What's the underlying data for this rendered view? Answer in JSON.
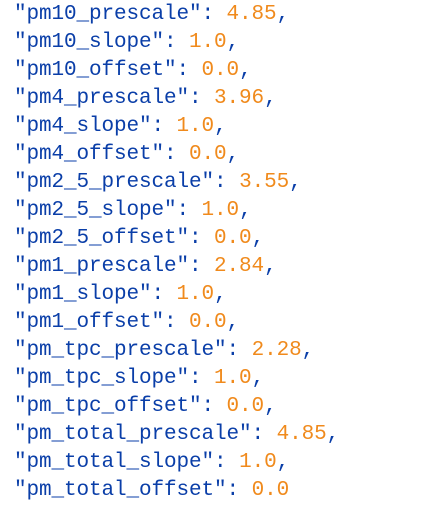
{
  "editor": {
    "lines": [
      {
        "key": "\"pm10_prescale\"",
        "value": "4.85",
        "trailing": ","
      },
      {
        "key": "\"pm10_slope\"",
        "value": "1.0",
        "trailing": ","
      },
      {
        "key": "\"pm10_offset\"",
        "value": "0.0",
        "trailing": ","
      },
      {
        "key": "\"pm4_prescale\"",
        "value": "3.96",
        "trailing": ","
      },
      {
        "key": "\"pm4_slope\"",
        "value": "1.0",
        "trailing": ","
      },
      {
        "key": "\"pm4_offset\"",
        "value": "0.0",
        "trailing": ","
      },
      {
        "key": "\"pm2_5_prescale\"",
        "value": "3.55",
        "trailing": ","
      },
      {
        "key": "\"pm2_5_slope\"",
        "value": "1.0",
        "trailing": ","
      },
      {
        "key": "\"pm2_5_offset\"",
        "value": "0.0",
        "trailing": ","
      },
      {
        "key": "\"pm1_prescale\"",
        "value": "2.84",
        "trailing": ","
      },
      {
        "key": "\"pm1_slope\"",
        "value": "1.0",
        "trailing": ","
      },
      {
        "key": "\"pm1_offset\"",
        "value": "0.0",
        "trailing": ","
      },
      {
        "key": "\"pm_tpc_prescale\"",
        "value": "2.28",
        "trailing": ","
      },
      {
        "key": "\"pm_tpc_slope\"",
        "value": "1.0",
        "trailing": ","
      },
      {
        "key": "\"pm_tpc_offset\"",
        "value": "0.0",
        "trailing": ","
      },
      {
        "key": "\"pm_total_prescale\"",
        "value": "4.85",
        "trailing": ","
      },
      {
        "key": "\"pm_total_slope\"",
        "value": "1.0",
        "trailing": ","
      },
      {
        "key": "\"pm_total_offset\"",
        "value": "0.0",
        "trailing": ""
      }
    ],
    "separator": ": "
  },
  "colors": {
    "key": "#0a3ea8",
    "number": "#f08a1c",
    "background": "#ffffff"
  }
}
